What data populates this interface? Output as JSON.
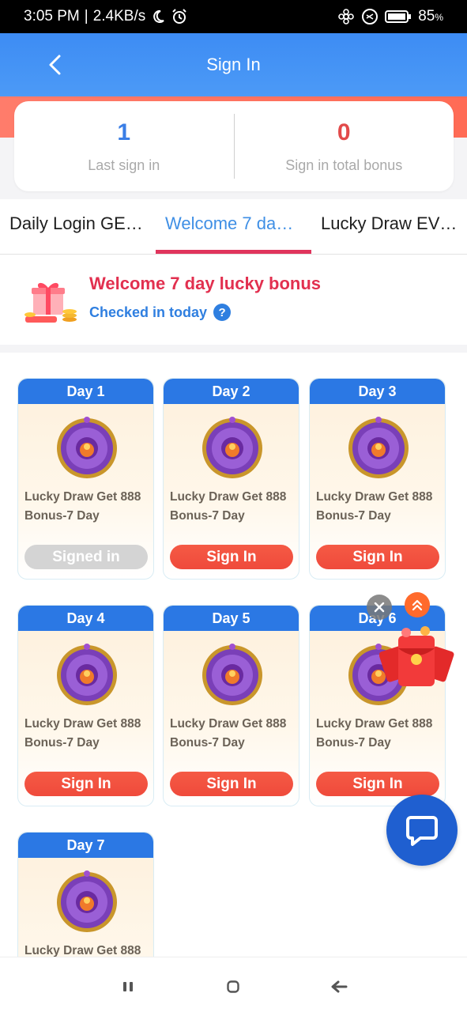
{
  "status_bar": {
    "time": "3:05 PM",
    "speed": "2.4KB/s",
    "battery": "85",
    "battery_unit": "%",
    "icons": [
      "moon-icon",
      "alarm-icon",
      "flower-icon",
      "sync-icon",
      "battery-icon"
    ]
  },
  "header": {
    "title": "Sign In",
    "back_icon": "chevron-left-icon"
  },
  "summary": {
    "last_sign_in_value": "1",
    "last_sign_in_label": "Last sign in",
    "total_bonus_value": "0",
    "total_bonus_label": "Sign in total bonus"
  },
  "tabs": [
    {
      "label": "Daily Login GE…",
      "active": false
    },
    {
      "label": "Welcome 7 da…",
      "active": true
    },
    {
      "label": "Lucky Draw EV…",
      "active": false
    }
  ],
  "welcome": {
    "title": "Welcome 7 day lucky bonus",
    "subtitle": "Checked in today",
    "help": "?"
  },
  "cards": [
    {
      "day": "Day 1",
      "desc_line1": "Lucky Draw Get 888",
      "desc_line2": "Bonus-7 Day",
      "button": "Signed in",
      "signed": true
    },
    {
      "day": "Day 2",
      "desc_line1": "Lucky Draw Get 888",
      "desc_line2": "Bonus-7 Day",
      "button": "Sign In",
      "signed": false
    },
    {
      "day": "Day 3",
      "desc_line1": "Lucky Draw Get 888",
      "desc_line2": "Bonus-7 Day",
      "button": "Sign In",
      "signed": false
    },
    {
      "day": "Day 4",
      "desc_line1": "Lucky Draw Get 888",
      "desc_line2": "Bonus-7 Day",
      "button": "Sign In",
      "signed": false
    },
    {
      "day": "Day 5",
      "desc_line1": "Lucky Draw Get 888",
      "desc_line2": "Bonus-7 Day",
      "button": "Sign In",
      "signed": false
    },
    {
      "day": "Day 6",
      "desc_line1": "Lucky Draw Get 888",
      "desc_line2": "Bonus-7 Day",
      "button": "Sign In",
      "signed": false
    },
    {
      "day": "Day 7",
      "desc_line1": "Lucky Draw Get 888",
      "desc_line2": "",
      "button": "",
      "signed": false
    }
  ],
  "colors": {
    "header_blue": "#3d8cf4",
    "title_red": "#e2304f",
    "link_blue": "#2f7fe0",
    "button_red": "#f55a45",
    "tab_underline": "#e0355d",
    "chat_blue": "#1f5fd0"
  }
}
